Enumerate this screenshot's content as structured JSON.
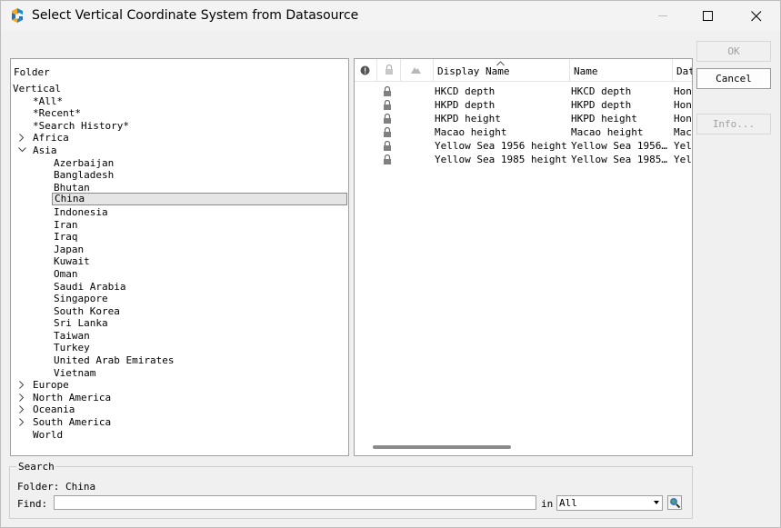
{
  "window": {
    "title": "Select Vertical Coordinate System from Datasource"
  },
  "folder_panel": {
    "header": "Folder",
    "tree": [
      {
        "label": "Vertical",
        "level": 0,
        "expander": "none"
      },
      {
        "label": "*All*",
        "level": 1,
        "expander": "none"
      },
      {
        "label": "*Recent*",
        "level": 1,
        "expander": "none"
      },
      {
        "label": "*Search History*",
        "level": 1,
        "expander": "none"
      },
      {
        "label": "Africa",
        "level": 1,
        "expander": "collapsed"
      },
      {
        "label": "Asia",
        "level": 1,
        "expander": "expanded"
      },
      {
        "label": "Azerbaijan",
        "level": 2,
        "expander": "none"
      },
      {
        "label": "Bangladesh",
        "level": 2,
        "expander": "none"
      },
      {
        "label": "Bhutan",
        "level": 2,
        "expander": "none"
      },
      {
        "label": "China",
        "level": 2,
        "expander": "none",
        "selected": true
      },
      {
        "label": "Indonesia",
        "level": 2,
        "expander": "none"
      },
      {
        "label": "Iran",
        "level": 2,
        "expander": "none"
      },
      {
        "label": "Iraq",
        "level": 2,
        "expander": "none"
      },
      {
        "label": "Japan",
        "level": 2,
        "expander": "none"
      },
      {
        "label": "Kuwait",
        "level": 2,
        "expander": "none"
      },
      {
        "label": "Oman",
        "level": 2,
        "expander": "none"
      },
      {
        "label": "Saudi Arabia",
        "level": 2,
        "expander": "none"
      },
      {
        "label": "Singapore",
        "level": 2,
        "expander": "none"
      },
      {
        "label": "South Korea",
        "level": 2,
        "expander": "none"
      },
      {
        "label": "Sri Lanka",
        "level": 2,
        "expander": "none"
      },
      {
        "label": "Taiwan",
        "level": 2,
        "expander": "none"
      },
      {
        "label": "Turkey",
        "level": 2,
        "expander": "none"
      },
      {
        "label": "United Arab Emirates",
        "level": 2,
        "expander": "none"
      },
      {
        "label": "Vietnam",
        "level": 2,
        "expander": "none"
      },
      {
        "label": "Europe",
        "level": 1,
        "expander": "collapsed"
      },
      {
        "label": "North America",
        "level": 1,
        "expander": "collapsed"
      },
      {
        "label": "Oceania",
        "level": 1,
        "expander": "collapsed"
      },
      {
        "label": "South America",
        "level": 1,
        "expander": "collapsed"
      },
      {
        "label": "World",
        "level": 1,
        "expander": "none"
      }
    ]
  },
  "list_panel": {
    "columns": {
      "status_icon": "info-circle-icon",
      "lock_icon": "lock-icon",
      "area_icon": "mountain-icon",
      "display_name": "Display Name",
      "name": "Name",
      "datum": "Dat"
    },
    "rows": [
      {
        "display_name": "HKCD depth",
        "name": "HKCD depth",
        "datum": "Hon"
      },
      {
        "display_name": "HKPD depth",
        "name": "HKPD depth",
        "datum": "Hon"
      },
      {
        "display_name": "HKPD height",
        "name": "HKPD height",
        "datum": "Hon"
      },
      {
        "display_name": "Macao height",
        "name": "Macao height",
        "datum": "Mac"
      },
      {
        "display_name": "Yellow Sea 1956 height",
        "name": "Yellow Sea 1956…",
        "datum": "Yel"
      },
      {
        "display_name": "Yellow Sea 1985 height",
        "name": "Yellow Sea 1985…",
        "datum": "Yel"
      }
    ]
  },
  "buttons": {
    "ok": "OK",
    "cancel": "Cancel",
    "info": "Info..."
  },
  "search": {
    "group_title": "Search",
    "folder_label": "Folder: China",
    "find_label": "Find:",
    "find_value": "",
    "in_label": "in",
    "in_value": "All"
  }
}
